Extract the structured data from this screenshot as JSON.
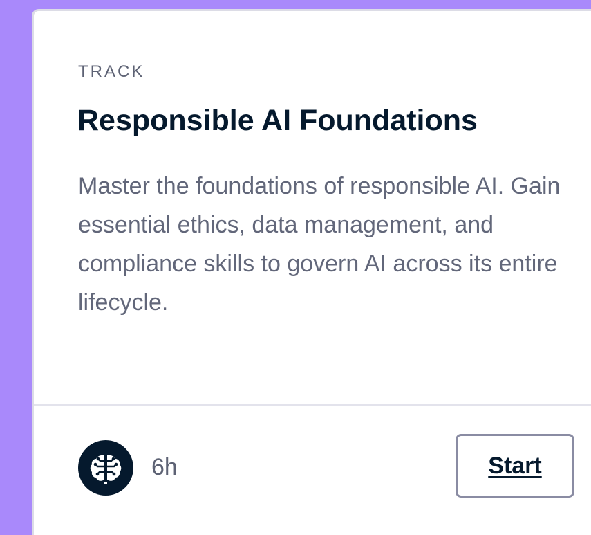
{
  "card": {
    "kicker": "TRACK",
    "title": "Responsible AI Foundations",
    "description": "Master the foundations of responsible AI. Gain essential ethics, data management, and compliance skills to govern AI across its entire lifecycle.",
    "duration": "6h",
    "icon": "brain-icon",
    "start_label": "Start"
  },
  "colors": {
    "page_background": "#a989fb",
    "title": "#05192d",
    "body_text": "#62677a",
    "icon_background": "#05192d",
    "button_border": "#8a8ca3"
  }
}
